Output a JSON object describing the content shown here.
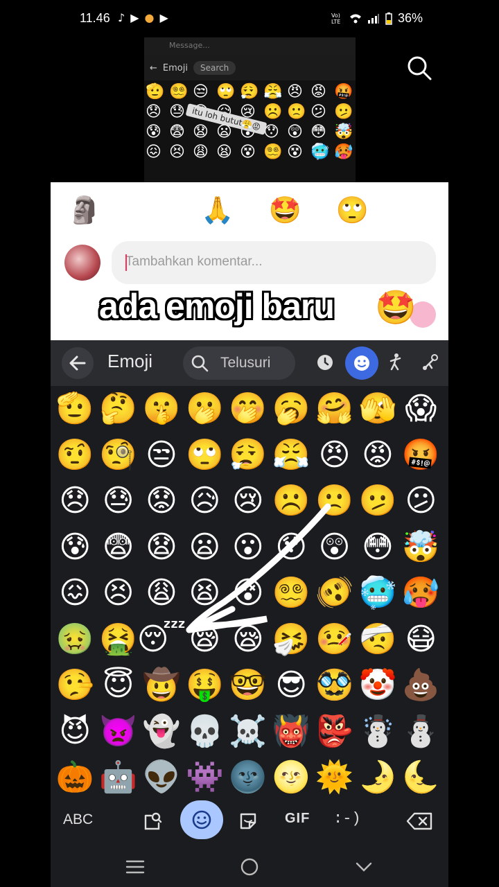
{
  "status_bar": {
    "time": "11.46",
    "left_icons": [
      "tiktok-icon",
      "youtube-icon",
      "coin-icon",
      "youtube-icon"
    ],
    "network_label": "Vo) LTE",
    "battery_text": "36%"
  },
  "thumbnail": {
    "message_placeholder": "Message...",
    "title": "Emoji",
    "search_placeholder": "Search",
    "sticker_text": "itu loh butut😤😡",
    "emojis": [
      "🫡",
      "😵‍💫",
      "😒",
      "🙄",
      "😮‍💨",
      "😤",
      "😠",
      "😡",
      "🤬",
      "😞",
      "😓",
      "😟",
      "😥",
      "😢",
      "☹️",
      "🙁",
      "😕",
      "🫤",
      "😰",
      "😨",
      "😧",
      "😦",
      "😮",
      "😯",
      "😲",
      "😳",
      "🤯",
      "😖",
      "😣",
      "😩",
      "😫",
      "😵",
      "😵‍💫",
      "😵",
      "🥶",
      "🥵"
    ]
  },
  "comment_panel": {
    "quick_reactions": [
      "🗿",
      "😹",
      "🙏",
      "🤩",
      "🙄",
      "😅"
    ],
    "input_placeholder": "Tambahkan komentar...",
    "caption_text": "ada emoji baru",
    "caption_emoji": "🤩"
  },
  "keyboard": {
    "header": {
      "title": "Emoji",
      "search_placeholder": "Telusuri"
    },
    "emojis": [
      "🫡",
      "🤔",
      "🤫",
      "🫢",
      "🤭",
      "🥱",
      "🤗",
      "🫣",
      "😱",
      "🤨",
      "🧐",
      "😒",
      "🙄",
      "😮‍💨",
      "😤",
      "😠",
      "😡",
      "🤬",
      "😞",
      "😓",
      "😟",
      "😥",
      "😢",
      "☹️",
      "🙁",
      "🫤",
      "😕",
      "😰",
      "😨",
      "😧",
      "😦",
      "😮",
      "😯",
      "😲",
      "😳",
      "🤯",
      "😖",
      "😣",
      "😩",
      "😫",
      "😵",
      "😵‍💫",
      "🫨",
      "🥶",
      "🥵",
      "🤢",
      "🤮",
      "😴",
      "😪",
      "😪",
      "🤧",
      "🤒",
      "🤕",
      "😷",
      "🤥",
      "😇",
      "🤠",
      "🤑",
      "🤓",
      "😎",
      "🥸",
      "🤡",
      "💩",
      "😈",
      "👿",
      "👻",
      "💀",
      "☠️",
      "👹",
      "👺",
      "☃️",
      "⛄",
      "🎃",
      "🤖",
      "👽",
      "👾",
      "🌚",
      "🌝",
      "🌞",
      "🌛",
      "🌜"
    ],
    "bottom_bar": {
      "abc_label": "ABC",
      "gif_label": "GIF",
      "emoticon_label": ":-)"
    }
  },
  "colors": {
    "keyboard_bg": "#1b1c1f",
    "header_bg": "#2b2c30",
    "accent_blue": "#3d6ae0",
    "active_light_blue": "#aac7ff",
    "caret_red": "#fe2c55"
  }
}
